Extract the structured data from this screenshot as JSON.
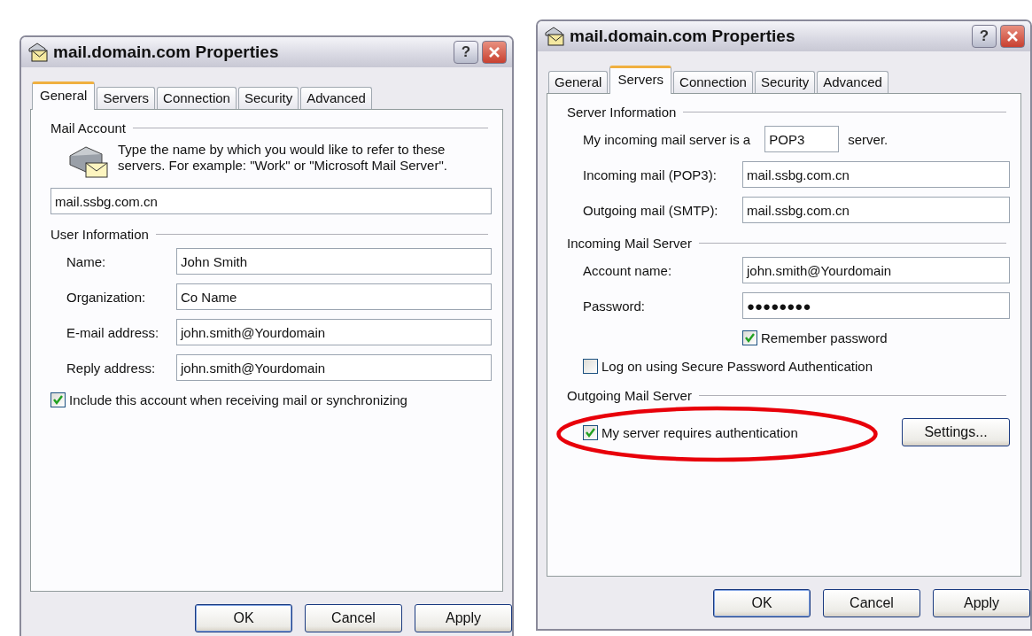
{
  "dialogs": [
    {
      "title": "mail.domain.com Properties",
      "help_button": "?",
      "tabs": [
        {
          "label": "General",
          "selected": true
        },
        {
          "label": "Servers",
          "selected": false
        },
        {
          "label": "Connection",
          "selected": false
        },
        {
          "label": "Security",
          "selected": false
        },
        {
          "label": "Advanced",
          "selected": false
        }
      ],
      "sections": [
        {
          "heading": "Mail Account",
          "rows": [
            {
              "kind": "description",
              "text": "Type the name by which you would like to refer to these servers.  For example: \"Work\" or \"Microsoft Mail Server\"."
            },
            {
              "kind": "input",
              "value": "mail.ssbg.com.cn"
            }
          ]
        },
        {
          "heading": "User Information",
          "rows": [
            {
              "kind": "field",
              "label": "Name:",
              "value": "John Smith"
            },
            {
              "kind": "field",
              "label": "Organization:",
              "value": "Co Name"
            },
            {
              "kind": "field",
              "label": "E-mail address:",
              "value": "john.smith@Yourdomain"
            },
            {
              "kind": "field",
              "label": "Reply address:",
              "value": "john.smith@Yourdomain"
            },
            {
              "kind": "checkbox",
              "label": "Include this account when receiving mail or synchronizing",
              "checked": true
            }
          ]
        }
      ],
      "buttons": [
        "OK",
        "Cancel",
        "Apply"
      ]
    },
    {
      "title": "mail.domain.com Properties",
      "help_button": "?",
      "tabs": [
        {
          "label": "General",
          "selected": false
        },
        {
          "label": "Servers",
          "selected": true
        },
        {
          "label": "Connection",
          "selected": false
        },
        {
          "label": "Security",
          "selected": false
        },
        {
          "label": "Advanced",
          "selected": false
        }
      ],
      "sections": [
        {
          "heading": "Server Information",
          "rows": [
            {
              "kind": "server_type",
              "label": "My incoming mail server is a",
              "value": "POP3",
              "suffix": "server."
            },
            {
              "kind": "field",
              "label": "Incoming mail (POP3):",
              "value": "mail.ssbg.com.cn"
            },
            {
              "kind": "field",
              "label": "Outgoing mail (SMTP):",
              "value": "mail.ssbg.com.cn"
            }
          ]
        },
        {
          "heading": "Incoming Mail Server",
          "rows": [
            {
              "kind": "field",
              "label": "Account name:",
              "value": "john.smith@Yourdomain"
            },
            {
              "kind": "field",
              "label": "Password:",
              "value": "●●●●●●●●"
            },
            {
              "kind": "aligned_checkbox",
              "label": "Remember password",
              "checked": true
            },
            {
              "kind": "checkbox",
              "label": "Log on using Secure Password Authentication",
              "checked": false
            }
          ]
        },
        {
          "heading": "Outgoing Mail Server",
          "rows": [
            {
              "kind": "checkbox_button",
              "label": "My server requires authentication",
              "checked": true,
              "button": "Settings...",
              "circled": true
            }
          ]
        }
      ],
      "buttons": [
        "OK",
        "Cancel",
        "Apply"
      ]
    }
  ]
}
